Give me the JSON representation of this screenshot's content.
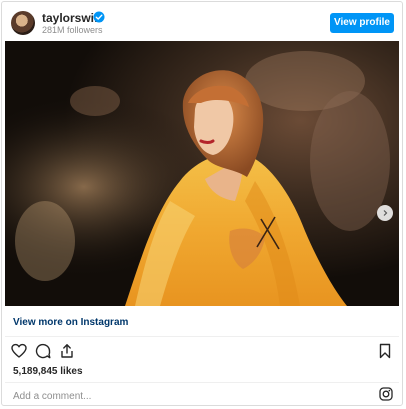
{
  "header": {
    "username": "taylorswift",
    "followers": "281M followers",
    "view_profile_label": "View profile",
    "avatar_icon": "profile-avatar",
    "verified_icon": "verified-badge-icon"
  },
  "media": {
    "next_icon": "chevron-right-icon",
    "carousel_dot_count": 10,
    "carousel_active_index": 0
  },
  "links": {
    "view_more": "View more on Instagram"
  },
  "actions": {
    "like_icon": "heart-icon",
    "comment_icon": "comment-icon",
    "share_icon": "share-icon",
    "save_icon": "bookmark-icon"
  },
  "likes": "5,189,845 likes",
  "comment": {
    "placeholder": "Add a comment..."
  },
  "brand": {
    "icon": "instagram-icon",
    "accent": "#0095f6",
    "link_color": "#00376b"
  }
}
